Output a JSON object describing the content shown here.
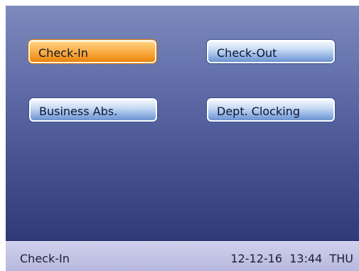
{
  "buttons": {
    "check_in": "Check-In",
    "check_out": "Check-Out",
    "business_abs": "Business Abs.",
    "dept_clocking": "Dept. Clocking"
  },
  "status": {
    "mode": "Check-In",
    "date": "12-12-16",
    "time": "13:44",
    "day": "THU"
  },
  "colors": {
    "screen_top": "#7c8abd",
    "screen_bottom": "#303a78",
    "selected_button": "#f49a27",
    "button": "#8fb1e2",
    "status_bar": "#c4c5e5"
  }
}
